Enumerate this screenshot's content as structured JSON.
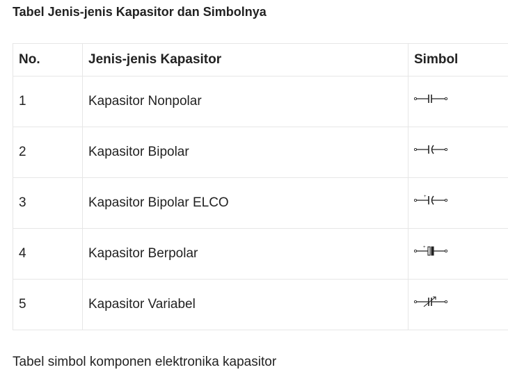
{
  "title": "Tabel Jenis-jenis Kapasitor dan Simbolnya",
  "table": {
    "headers": [
      "No.",
      "Jenis-jenis Kapasitor",
      "Simbol"
    ],
    "rows": [
      {
        "no": "1",
        "name": "Kapasitor Nonpolar",
        "symbol_icon": "nonpolar-capacitor-symbol-icon"
      },
      {
        "no": "2",
        "name": "Kapasitor Bipolar",
        "symbol_icon": "bipolar-capacitor-symbol-icon"
      },
      {
        "no": "3",
        "name": "Kapasitor Bipolar ELCO",
        "symbol_icon": "bipolar-elco-capacitor-symbol-icon",
        "symbol_mark": "+"
      },
      {
        "no": "4",
        "name": "Kapasitor Berpolar",
        "symbol_icon": "polarized-capacitor-symbol-icon",
        "symbol_mark": "+"
      },
      {
        "no": "5",
        "name": "Kapasitor Variabel",
        "symbol_icon": "variable-capacitor-symbol-icon"
      }
    ]
  },
  "caption": "Tabel simbol komponen elektronika kapasitor"
}
